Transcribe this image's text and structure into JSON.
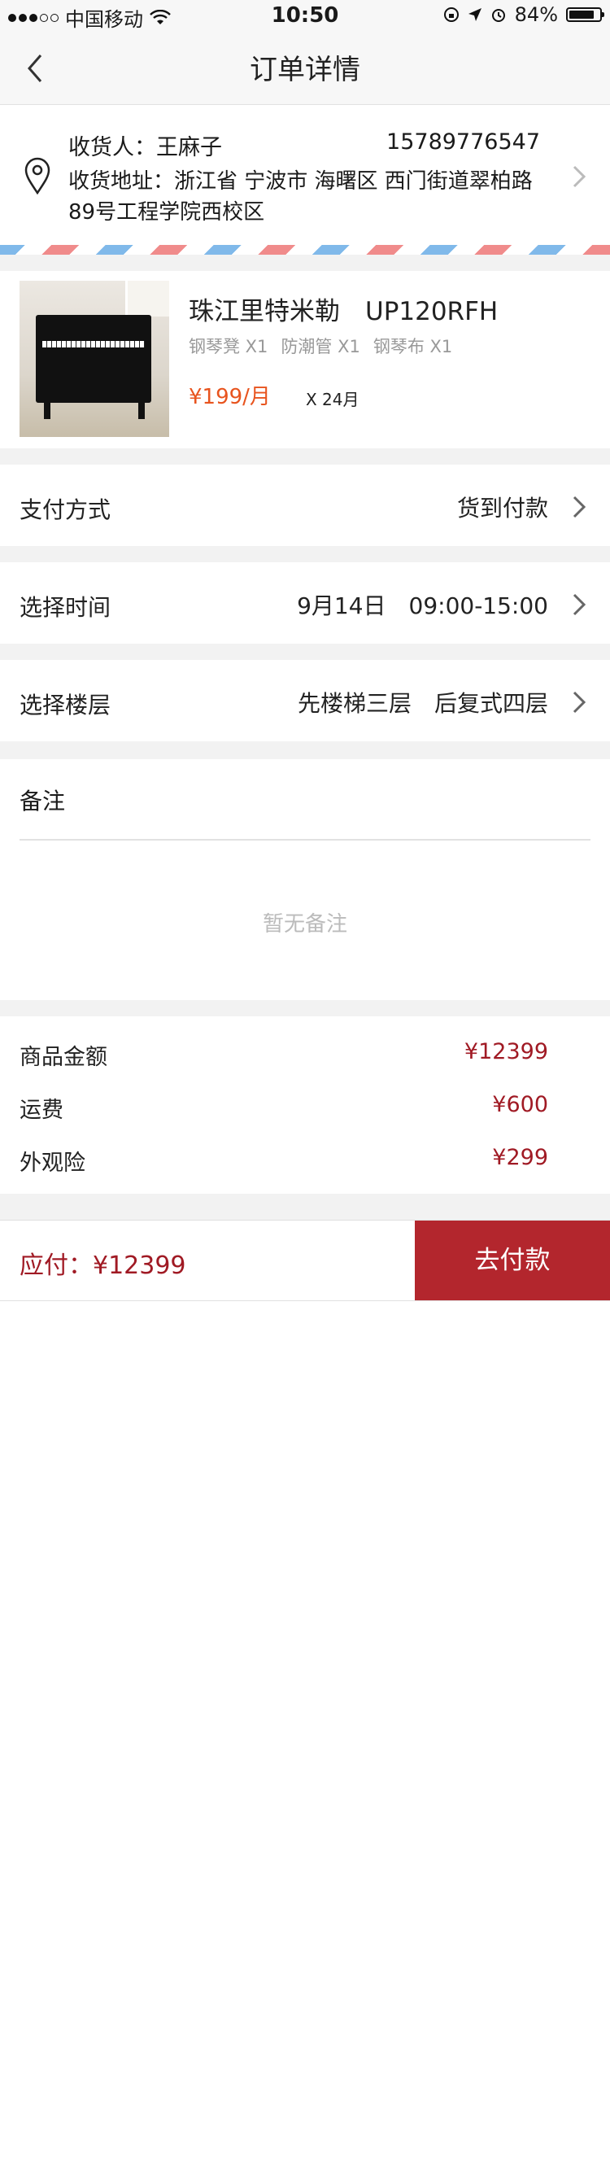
{
  "status_bar": {
    "carrier": "中国移动",
    "time": "10:50",
    "battery": "84%",
    "battery_level": 0.84,
    "signal_icon": "signal-dots-icon",
    "wifi_icon": "wifi-icon"
  },
  "nav": {
    "title": "订单详情",
    "back_icon": "chevron-left-icon"
  },
  "address": {
    "receiver": "收货人：王麻子",
    "phone": "15789776547",
    "address": "收货地址：浙江省 宁波市 海曙区 西门街道翠柏路89号工程学院西校区",
    "pin_icon": "location-pin-icon"
  },
  "product": {
    "name": "珠江里特米勒　UP120RFH",
    "extras": [
      "钢琴凳 X1",
      "防潮管 X1",
      "钢琴布 X1"
    ],
    "price": "¥199/月",
    "term": "X 24月"
  },
  "rows": {
    "payment": {
      "label": "支付方式",
      "value": "货到付款"
    },
    "time": {
      "label": "选择时间",
      "value": "9月14日　09:00-15:00"
    },
    "floor": {
      "label": "选择楼层",
      "value": "先楼梯三层　后复式四层"
    }
  },
  "remark": {
    "label": "备注",
    "placeholder": "暂无备注"
  },
  "fees": [
    {
      "label": "商品金额",
      "amount": "¥12399"
    },
    {
      "label": "运费",
      "amount": "¥600"
    },
    {
      "label": "外观险",
      "amount": "¥299"
    }
  ],
  "pay_bar": {
    "due": "应付：¥12399",
    "button": "去付款"
  },
  "colors": {
    "accent": "#b3262d",
    "price_orange": "#e8541e",
    "amount_red": "#a01a24"
  }
}
